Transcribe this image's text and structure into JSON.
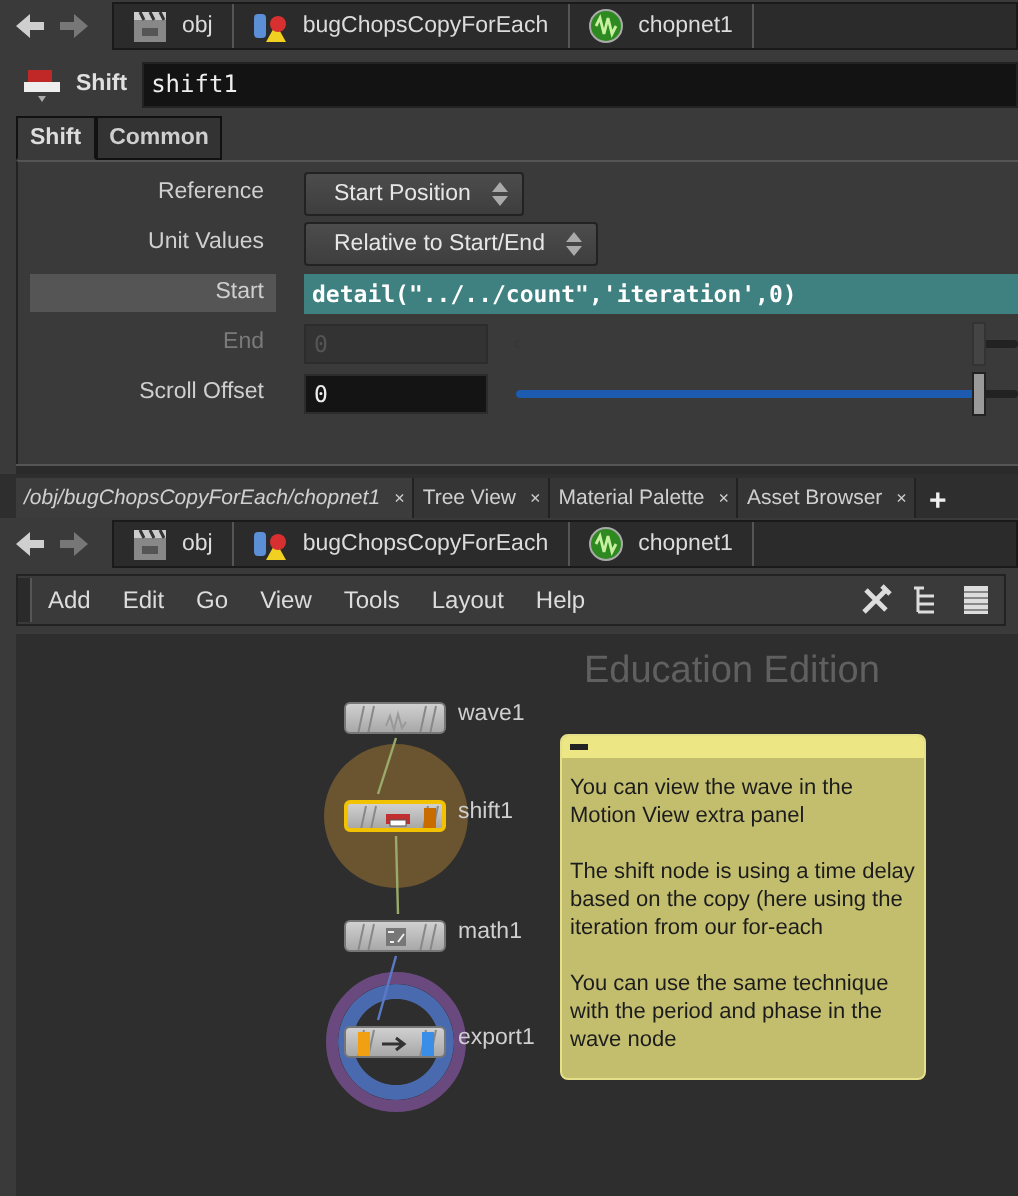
{
  "path_bar_top": {
    "crumbs": [
      {
        "kind": "obj",
        "label": "obj"
      },
      {
        "kind": "geo",
        "label": "bugChopsCopyForEach"
      },
      {
        "kind": "chop",
        "label": "chopnet1"
      }
    ]
  },
  "parameter_header": {
    "node_type": "Shift",
    "node_name": "shift1"
  },
  "parameter_tabs": [
    {
      "label": "Shift",
      "selected": true
    },
    {
      "label": "Common",
      "selected": false
    }
  ],
  "parameters": [
    {
      "kind": "menu",
      "label": "Reference",
      "value": "Start Position",
      "highlighted": false,
      "disabled": false
    },
    {
      "kind": "menu",
      "label": "Unit Values",
      "value": "Relative to Start/End",
      "highlighted": false,
      "disabled": false
    },
    {
      "kind": "expression",
      "label": "Start",
      "value": "detail(\"../../count\",'iteration',0)",
      "highlighted": true,
      "disabled": false
    },
    {
      "kind": "slider",
      "label": "End",
      "value": "0",
      "level": 0.92,
      "highlighted": false,
      "disabled": true
    },
    {
      "kind": "slider",
      "label": "Scroll Offset",
      "value": "0",
      "level": 0.92,
      "highlighted": false,
      "disabled": false
    }
  ],
  "pane_tabs": [
    {
      "label": "/obj/bugChopsCopyForEach/chopnet1",
      "selected": true,
      "close": "×"
    },
    {
      "label": "Tree View",
      "selected": false,
      "close": "×"
    },
    {
      "label": "Material Palette",
      "selected": false,
      "close": "×"
    },
    {
      "label": "Asset Browser",
      "selected": false,
      "close": "×"
    }
  ],
  "add_tab": "+",
  "path_bar_network": {
    "crumbs": [
      {
        "kind": "obj",
        "label": "obj"
      },
      {
        "kind": "geo",
        "label": "bugChopsCopyForEach"
      },
      {
        "kind": "chop",
        "label": "chopnet1"
      }
    ]
  },
  "menu": [
    "Add",
    "Edit",
    "Go",
    "View",
    "Tools",
    "Layout",
    "Help"
  ],
  "network": {
    "edition_label": "Education Edition",
    "nodes": [
      {
        "name": "wave1",
        "kind": "wave",
        "selected": false
      },
      {
        "name": "shift1",
        "kind": "shift",
        "selected": true,
        "halo": {
          "kind": "current"
        },
        "flags": [
          {
            "kind": "right",
            "color": "#c86c00"
          }
        ],
        "input_wire": {
          "color": "#9aaa6a"
        }
      },
      {
        "name": "math1",
        "kind": "math",
        "selected": false,
        "input_wire": {
          "color": "#9aaa6a"
        }
      },
      {
        "name": "export1",
        "kind": "export",
        "selected": false,
        "halo": {
          "kind": "export"
        },
        "flags": [
          {
            "kind": "left",
            "color": "#f0a010"
          },
          {
            "kind": "right",
            "color": "#3a8ee8"
          }
        ],
        "input_wire": {
          "color": "#5a7ac8"
        }
      }
    ],
    "sticky_note": {
      "paragraphs": [
        "You can view the wave in the Motion View extra panel",
        "The shift node is using a time delay based on the copy (here using the iteration from our for-each",
        "You can use the same technique with the period and phase in the wave node"
      ]
    }
  }
}
